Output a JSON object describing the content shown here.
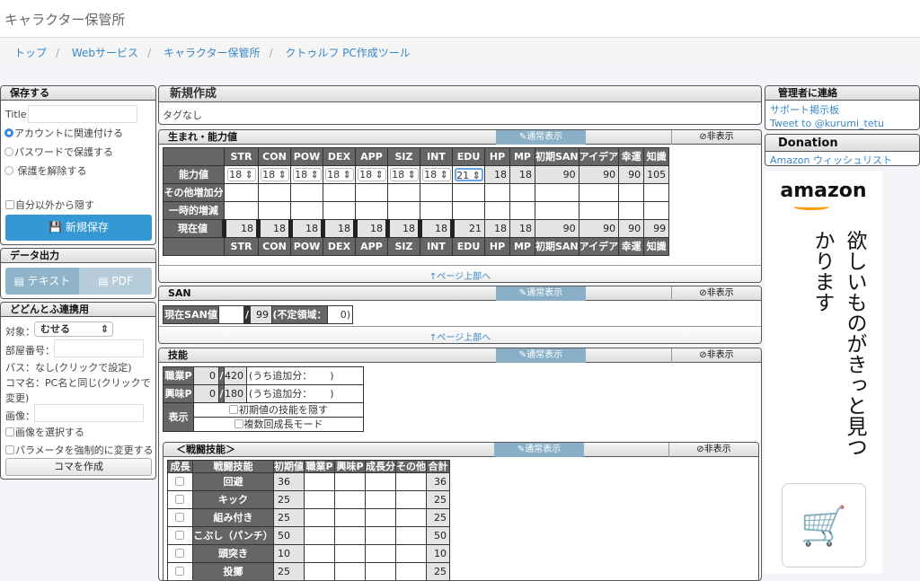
{
  "header": {
    "title": "キャラクター保管所"
  },
  "breadcrumb": [
    "トップ",
    "Webサービス",
    "キャラクター保管所",
    "クトゥルフ PC作成ツール"
  ],
  "save": {
    "title": "保存する",
    "title_label": "Title:",
    "radios": [
      "アカウントに関連付ける",
      "パスワードで保護する",
      "保護を解除する"
    ],
    "hide": "自分以外から隠す",
    "save_button": "新規保存"
  },
  "export": {
    "title": "データ出力",
    "text": "テキスト",
    "pdf": "PDF"
  },
  "dodontof": {
    "title": "どどんとふ連携用",
    "target_label": "対象：",
    "target_value": "むせる",
    "room_label": "部屋番号：",
    "pass": "パス：なし(クリックで設定)",
    "koma": "コマ名：PC名と同じ(クリックで変更)",
    "image_label": "画像：",
    "select_image": "画像を選択する",
    "force": "パラメータを強制的に変更する",
    "create": "コマを作成"
  },
  "newchar": {
    "title": "新規作成",
    "tags": "タグなし"
  },
  "common": {
    "normal": "通常表示",
    "hide": "非表示",
    "to_top": "↑ページ上部へ"
  },
  "abilities": {
    "title": "生まれ・能力値",
    "headers": [
      "STR",
      "CON",
      "POW",
      "DEX",
      "APP",
      "SIZ",
      "INT",
      "EDU",
      "HP",
      "MP",
      "初期SAN",
      "アイデア",
      "幸運",
      "知識"
    ],
    "row_labels": [
      "能力値",
      "その他増加分",
      "一時的増減",
      "現在値"
    ],
    "base": [
      "18",
      "18",
      "18",
      "18",
      "18",
      "18",
      "18",
      "21",
      "18",
      "18",
      "90",
      "90",
      "90",
      "105"
    ],
    "current": [
      "18",
      "18",
      "18",
      "18",
      "18",
      "18",
      "18",
      "21",
      "18",
      "18",
      "90",
      "90",
      "90",
      "99"
    ]
  },
  "san": {
    "title": "SAN",
    "current_label": "現在SAN値",
    "current": "",
    "slash": "/",
    "max": "99",
    "indef_label": "(不定領域：",
    "indef": "0",
    ")": ")"
  },
  "skills": {
    "title": "技能",
    "job_label": "職業P",
    "job_used": "0",
    "job_total": "420",
    "extra_label": "(うち追加分：",
    "close": ")",
    "hobby_label": "興味P",
    "hobby_used": "0",
    "hobby_total": "180",
    "display_label": "表示",
    "hide_initial": "初期値の技能を隠す",
    "multi_growth": "複数回成長モード"
  },
  "combat": {
    "title": "＜戦闘技能＞",
    "headers": [
      "成長",
      "戦闘技能",
      "初期値",
      "職業P",
      "興味P",
      "成長分",
      "その他",
      "合計"
    ],
    "rows": [
      {
        "name": "回避",
        "init": "36",
        "total": "36"
      },
      {
        "name": "キック",
        "init": "25",
        "total": "25"
      },
      {
        "name": "組み付き",
        "init": "25",
        "total": "25"
      },
      {
        "name": "こぶし（パンチ）",
        "init": "50",
        "total": "50"
      },
      {
        "name": "頭突き",
        "init": "10",
        "total": "10"
      },
      {
        "name": "投擲",
        "init": "25",
        "total": "25"
      }
    ]
  },
  "contact": {
    "title": "管理者に連絡",
    "links": [
      "サポート掲示板",
      "Tweet to @kurumi_tetu"
    ]
  },
  "donation": {
    "title": "Donation",
    "link": "Amazon ウィッシュリスト",
    "ad_logo": "amazon",
    "ad_text": "欲しいものがきっと見つかります"
  }
}
